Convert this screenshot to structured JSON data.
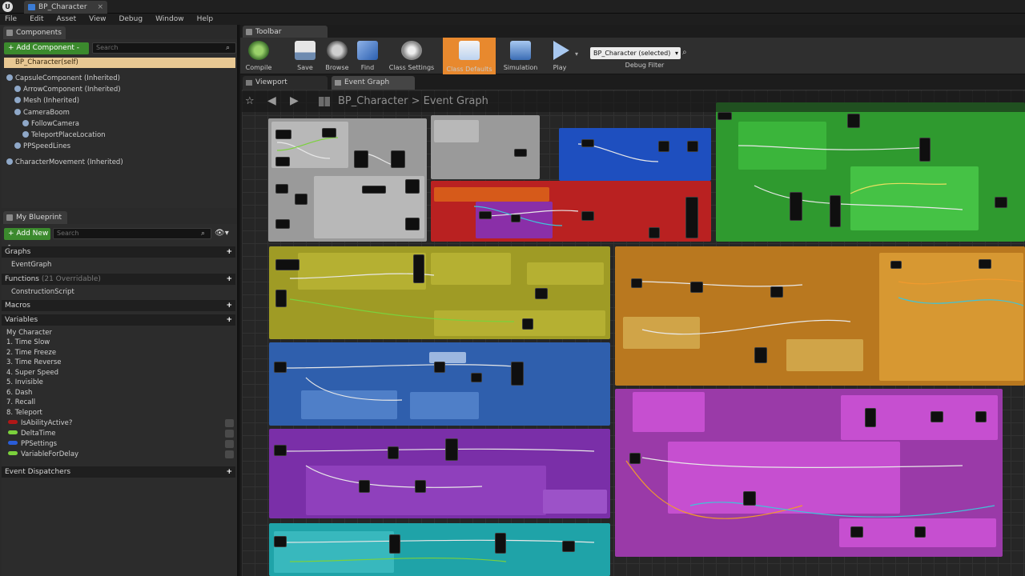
{
  "window": {
    "tab_title": "BP_Character"
  },
  "menu": [
    "File",
    "Edit",
    "Asset",
    "View",
    "Debug",
    "Window",
    "Help"
  ],
  "components_panel": {
    "tab_label": "Components",
    "add_button": "+ Add Component -",
    "search_placeholder": "Search",
    "root_label": "BP_Character(self)",
    "tree": [
      {
        "label": "CapsuleComponent (Inherited)"
      },
      {
        "label": "ArrowComponent (Inherited)"
      },
      {
        "label": "Mesh (Inherited)"
      },
      {
        "label": "CameraBoom"
      },
      {
        "label": "FollowCamera"
      },
      {
        "label": "TeleportPlaceLocation"
      },
      {
        "label": "PPSpeedLines"
      },
      {
        "label": "CharacterMovement (Inherited)"
      }
    ]
  },
  "my_blueprint_panel": {
    "tab_label": "My Blueprint",
    "add_button": "+ Add New -",
    "search_placeholder": "Search",
    "sections": {
      "graphs": "Graphs",
      "event_graph": "EventGraph",
      "functions": "Functions",
      "functions_note": "(21 Overridable)",
      "construction_script": "ConstructionScript",
      "macros": "Macros",
      "variables": "Variables",
      "event_dispatchers": "Event Dispatchers"
    },
    "variable_categories": [
      "My Character",
      "1. Time Slow",
      "2. Time Freeze",
      "3. Time Reverse",
      "4. Super Speed",
      "5. Invisible",
      "6. Dash",
      "7. Recall",
      "8. Teleport"
    ],
    "variables": [
      {
        "name": "IsAbilityActive?",
        "color": "#b01717"
      },
      {
        "name": "DeltaTime",
        "color": "#7bd13c"
      },
      {
        "name": "PPSettings",
        "color": "#2a5dd8"
      },
      {
        "name": "VariableForDelay",
        "color": "#7bd13c"
      }
    ]
  },
  "editor": {
    "toolbar_tab": "Toolbar",
    "tools": [
      {
        "label": "Compile",
        "icon": "compile-icon",
        "color": "#5fa83a"
      },
      {
        "label": "Save",
        "icon": "save-icon",
        "color": "#d6d6d6"
      },
      {
        "label": "Browse",
        "icon": "browse-icon",
        "color": "#bdbdbd"
      },
      {
        "label": "Find",
        "icon": "find-icon",
        "color": "#6f9ad8"
      },
      {
        "label": "Class Settings",
        "icon": "gear-icon",
        "color": "#c9c9c9"
      },
      {
        "label": "Class Defaults",
        "icon": "defaults-icon",
        "color": "#e8892e"
      },
      {
        "label": "Simulation",
        "icon": "simulation-icon",
        "color": "#6f9ad8"
      },
      {
        "label": "Play",
        "icon": "play-icon",
        "color": "#a8c8f0"
      }
    ],
    "debug_filter_value": "BP_Character (selected)",
    "debug_filter_label": "Debug Filter",
    "sub_tabs": [
      "Viewport",
      "Event Graph"
    ],
    "breadcrumb": {
      "blueprint": "BP_Character",
      "separator": ">",
      "graph": "Event Graph"
    }
  },
  "colors": {
    "comment_grey": "#9a9a9a",
    "comment_lightgrey": "#b8b8b8",
    "comment_blue": "#1e4fbf",
    "comment_red": "#b92121",
    "comment_green": "#2f9a2f",
    "comment_olive": "#9f9b25",
    "comment_orange": "#b9781f",
    "comment_steelblue": "#2f5fad",
    "comment_purple": "#7a2fa8",
    "comment_magenta": "#b43fbf",
    "comment_teal": "#1fa3a8"
  }
}
